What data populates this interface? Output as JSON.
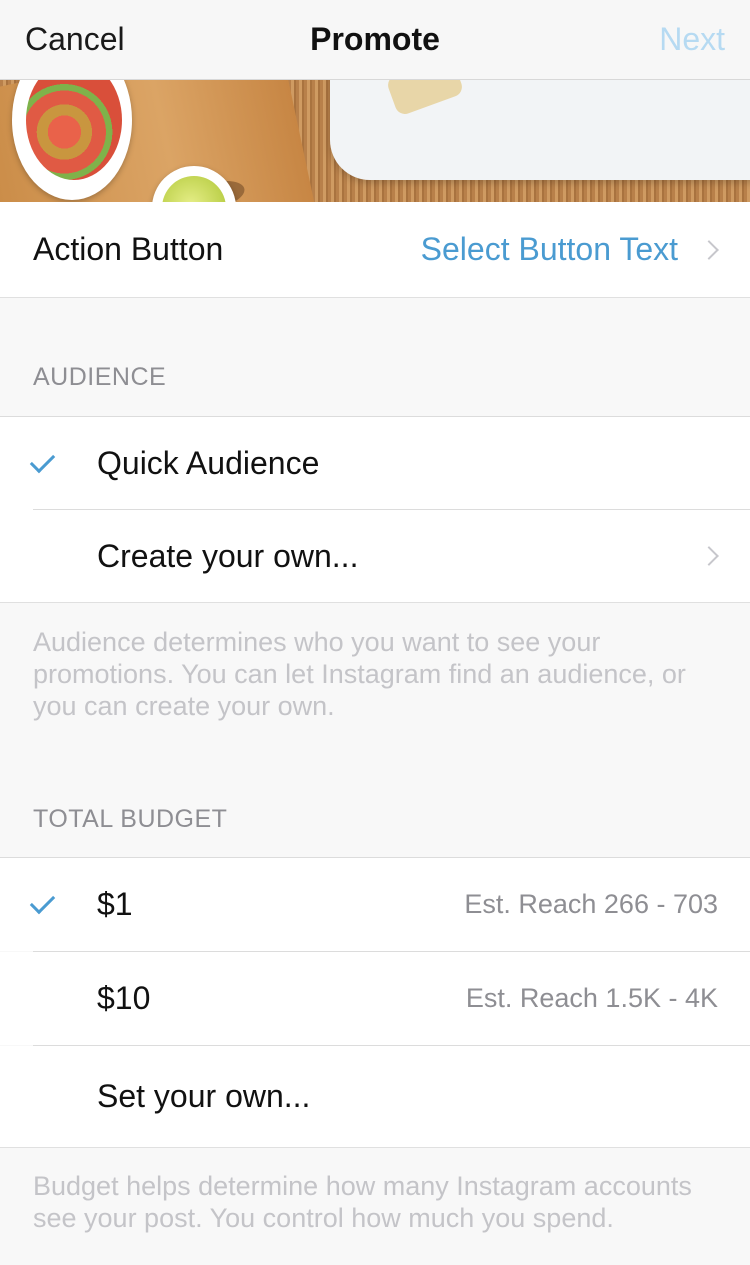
{
  "navbar": {
    "cancel_label": "Cancel",
    "title": "Promote",
    "next_label": "Next"
  },
  "action_button": {
    "label": "Action Button",
    "value": "Select Button Text"
  },
  "audience": {
    "header": "AUDIENCE",
    "options": [
      {
        "label": "Quick Audience",
        "selected": true
      },
      {
        "label": "Create your own...",
        "selected": false
      }
    ],
    "footnote": "Audience determines who you want to see your promotions. You can let Instagram find an audience, or you can create your own."
  },
  "budget": {
    "header": "TOTAL BUDGET",
    "options": [
      {
        "label": "$1",
        "reach": "Est. Reach 266 - 703",
        "selected": true
      },
      {
        "label": "$10",
        "reach": "Est. Reach 1.5K - 4K",
        "selected": false
      },
      {
        "label": "Set your own...",
        "selected": false
      }
    ],
    "footnote": "Budget helps determine how many Instagram accounts see your post. You control how much you spend."
  },
  "colors": {
    "accent": "#4a9bd1",
    "next_disabled": "#b6daf2",
    "background": "#f8f8f8"
  },
  "icons": {
    "check": "checkmark-icon",
    "chevron": "chevron-right-icon"
  }
}
